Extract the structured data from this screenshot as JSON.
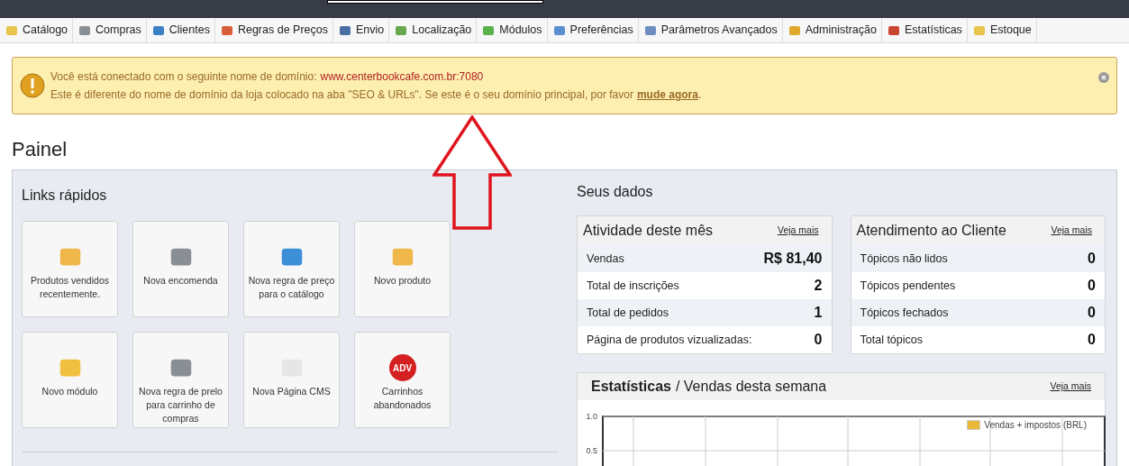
{
  "nav": [
    {
      "label": "Catálogo"
    },
    {
      "label": "Compras"
    },
    {
      "label": "Clientes"
    },
    {
      "label": "Regras de Preços"
    },
    {
      "label": "Envio"
    },
    {
      "label": "Localização"
    },
    {
      "label": "Módulos"
    },
    {
      "label": "Preferências"
    },
    {
      "label": "Parâmetros Avançados"
    },
    {
      "label": "Administração"
    },
    {
      "label": "Estatísticas"
    },
    {
      "label": "Estoque"
    }
  ],
  "alert": {
    "line1": "Você está conectado com o seguinte nome de domínio:",
    "domain": "www.centerbookcafe.com.br:7080",
    "line2": "Este é diferente do nome de domínio da loja colocado na aba \"SEO & URLs\". Se este é o seu domínio principal, por favor",
    "link": "mude agora",
    "end": "."
  },
  "page_title": "Painel",
  "quick_links": {
    "title": "Links rápidos",
    "items": [
      {
        "label": "Produtos vendidos recentemente."
      },
      {
        "label": "Nova encomenda"
      },
      {
        "label": "Nova regra de preço para o catálogo"
      },
      {
        "label": "Novo produto"
      },
      {
        "label": "Novo módulo"
      },
      {
        "label": "Nova regra de prelo para carrinho de compras"
      },
      {
        "label": "Nova Página CMS"
      },
      {
        "label": "Carrinhos abandonados",
        "badge": "ADV"
      }
    ]
  },
  "your_data": {
    "title": "Seus dados",
    "cards": [
      {
        "title": "Atividade deste mês",
        "link": "Veja mais",
        "rows": [
          {
            "label": "Vendas",
            "value": "R$ 81,40"
          },
          {
            "label": "Total de inscrições",
            "value": "2"
          },
          {
            "label": "Total de pedidos",
            "value": "1"
          },
          {
            "label": "Página de produtos vizualizadas:",
            "value": "0"
          }
        ]
      },
      {
        "title": "Atendimento ao Cliente",
        "link": "Veja mais",
        "rows": [
          {
            "label": "Tópicos não lidos",
            "value": "0"
          },
          {
            "label": "Tópicos pendentes",
            "value": "0"
          },
          {
            "label": "Tópicos fechados",
            "value": "0"
          },
          {
            "label": "Total tópicos",
            "value": "0"
          }
        ]
      }
    ]
  },
  "stats": {
    "title": "Estatísticas",
    "subtitle": "/ Vendas desta semana",
    "link": "Veja mais",
    "chart_data": {
      "type": "line",
      "ylim": [
        0,
        1
      ],
      "yticks": [
        {
          "value": 1,
          "label": "1.0"
        },
        {
          "value": 0.5,
          "label": "0.5"
        }
      ],
      "series": [
        {
          "name": "Vendas + impostos (BRL)",
          "color": "#e8b93b"
        }
      ]
    }
  }
}
